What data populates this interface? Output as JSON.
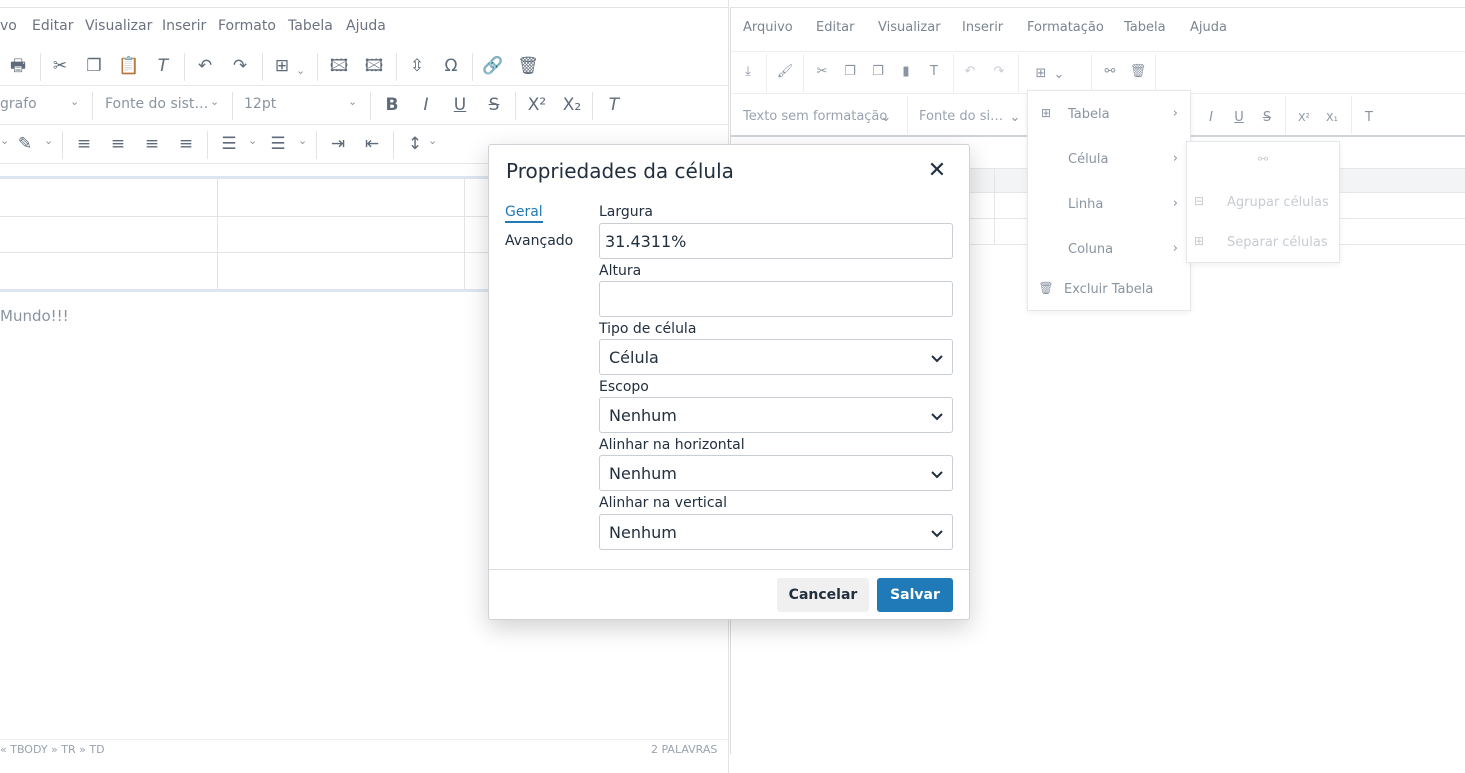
{
  "left_editor": {
    "menu": [
      "vo",
      "Editar",
      "Visualizar",
      "Inserir",
      "Formato",
      "Tabela",
      "Ajuda"
    ],
    "toolbar2": {
      "block_format": "grafo",
      "font_family": "Fonte do sist…",
      "font_size": "12pt"
    },
    "content_text": "Mundo!!!",
    "statusbar": {
      "path": "« TBODY » TR » TD",
      "words": "2 PALAVRAS"
    }
  },
  "right_editor": {
    "menu": [
      "Arquivo",
      "Editar",
      "Visualizar",
      "Inserir",
      "Formatação",
      "Tabela",
      "Ajuda"
    ],
    "toolbar2": {
      "block_format": "Texto sem formatação",
      "font_family": "Fonte do si…"
    },
    "table_menu": [
      {
        "label": "Tabela",
        "icon": "table-icon"
      },
      {
        "label": "Célula",
        "icon": ""
      },
      {
        "label": "Linha",
        "icon": ""
      },
      {
        "label": "Coluna",
        "icon": ""
      },
      {
        "label": "Excluir Tabela",
        "icon": "trash-icon"
      }
    ],
    "cell_submenu": [
      "Agrupar células",
      "Separar células"
    ]
  },
  "dialog": {
    "title": "Propriedades da célula",
    "tabs": {
      "general": "Geral",
      "advanced": "Avançado"
    },
    "fields": {
      "width_label": "Largura",
      "width_value": "31.4311%",
      "height_label": "Altura",
      "height_value": "",
      "cell_type_label": "Tipo de célula",
      "cell_type_value": "Célula",
      "scope_label": "Escopo",
      "scope_value": "Nenhum",
      "h_align_label": "Alinhar na horizontal",
      "h_align_value": "Nenhum",
      "v_align_label": "Alinhar na vertical",
      "v_align_value": "Nenhum"
    },
    "buttons": {
      "cancel": "Cancelar",
      "save": "Salvar"
    }
  },
  "colors": {
    "primary": "#207ab7",
    "text": "#222f3e",
    "muted": "#8a94a1"
  }
}
